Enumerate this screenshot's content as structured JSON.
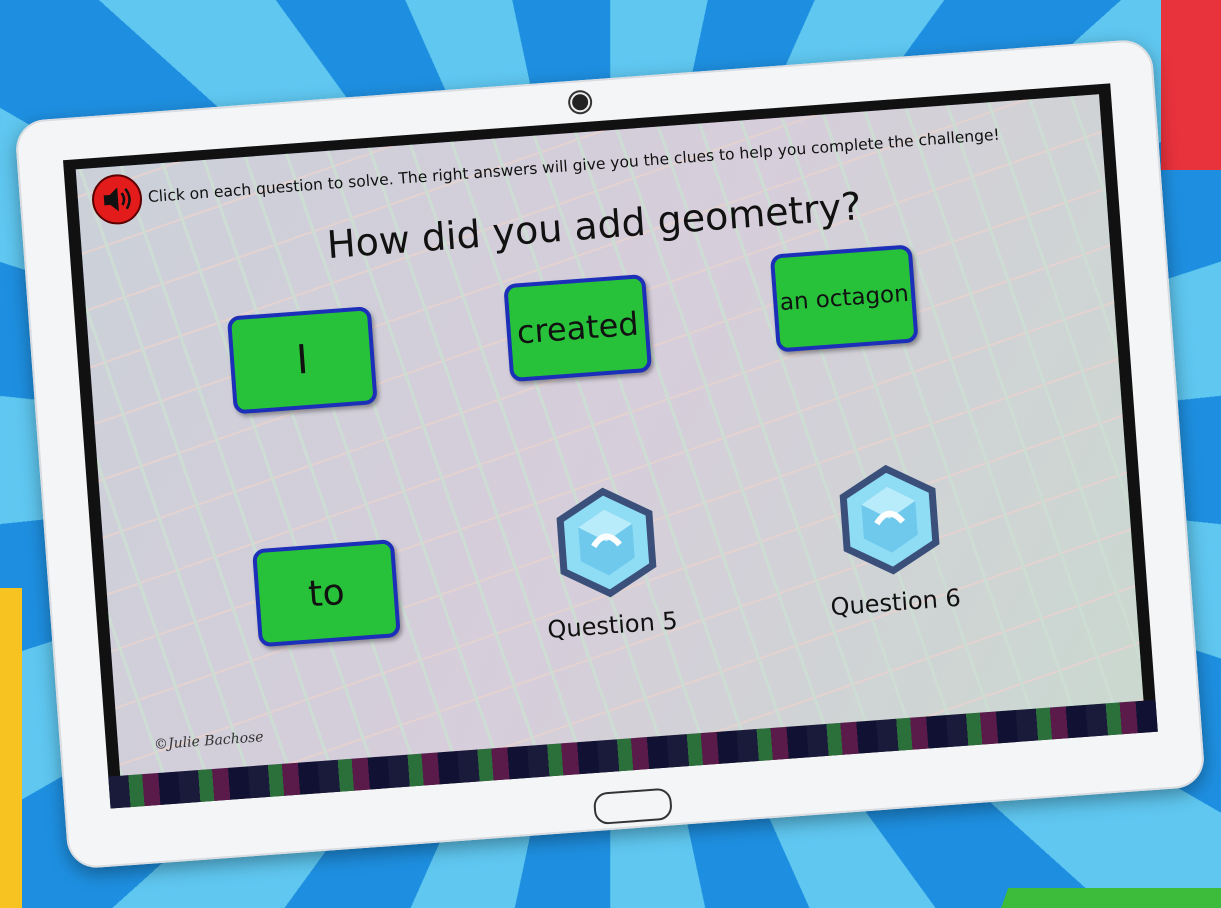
{
  "header": {
    "instructions": "Click on each question to solve. The right answers will give you the clues to help you complete the challenge!",
    "sound_icon": "speaker-icon"
  },
  "question": {
    "title": "How did you add geometry?"
  },
  "answers": [
    {
      "label": "I"
    },
    {
      "label": "created"
    },
    {
      "label": "an octagon"
    },
    {
      "label": "to"
    }
  ],
  "questions": [
    {
      "label": "Question 5",
      "icon": "gem-icon"
    },
    {
      "label": "Question 6",
      "icon": "gem-icon"
    }
  ],
  "footer": {
    "copyright": "©Julie Bachose"
  },
  "colors": {
    "answer_fill": "#27c23a",
    "answer_border": "#1b2fb8",
    "sound_button": "#e31b1b",
    "gem_light": "#8fdcf5",
    "gem_dark": "#3a4f7a"
  }
}
